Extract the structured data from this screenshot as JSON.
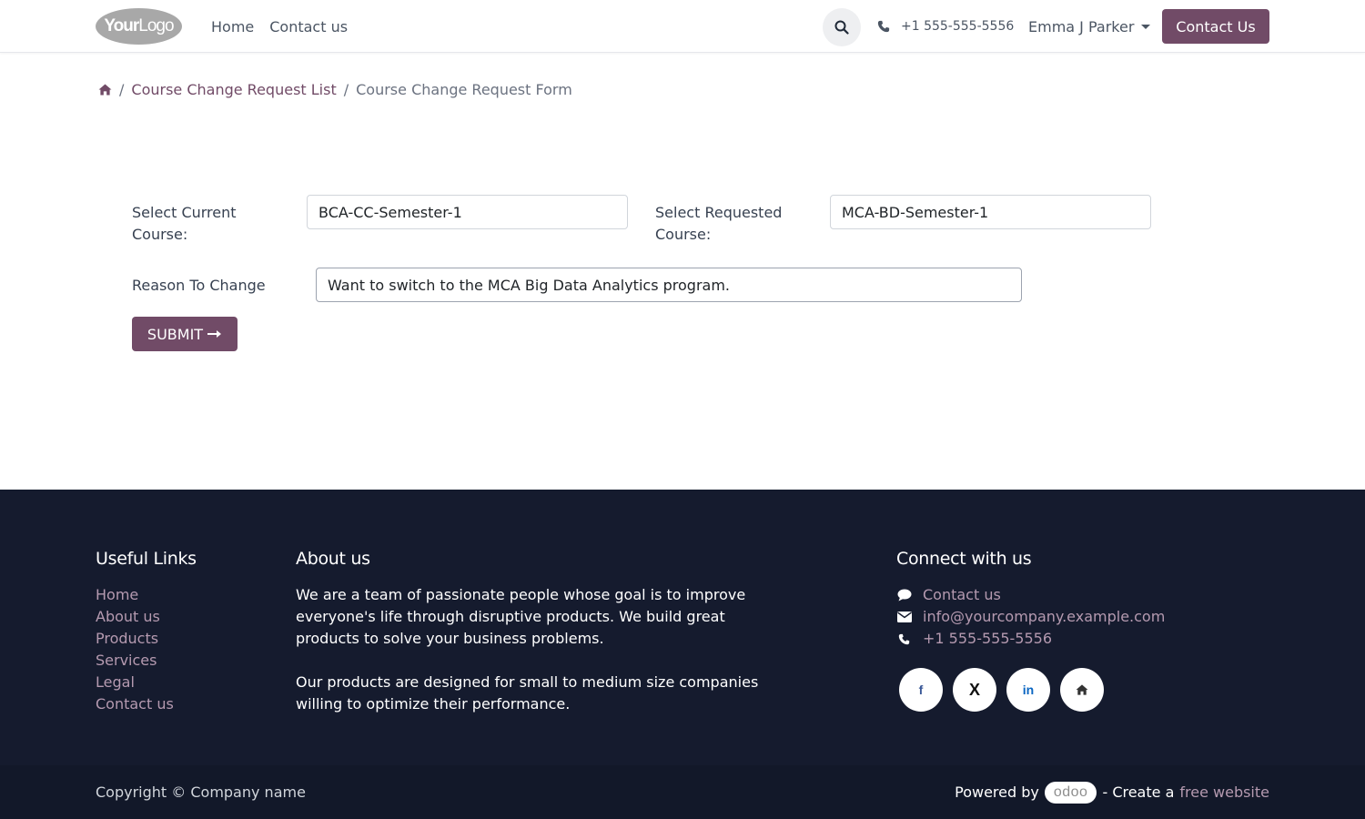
{
  "header": {
    "logo_text_bold": "Your",
    "logo_text": "Logo",
    "nav": [
      "Home",
      "Contact us"
    ],
    "phone": "+1 555-555-5556",
    "user_name": "Emma J Parker",
    "contact_button": "Contact Us"
  },
  "breadcrumb": {
    "items": [
      "Course Change Request List",
      "Course Change Request Form"
    ],
    "separator": "/"
  },
  "form": {
    "current_course_label": "Select Current Course:",
    "current_course_value": "BCA-CC-Semester-1",
    "requested_course_label": "Select Requested Course:",
    "requested_course_value": "MCA-BD-Semester-1",
    "reason_label": "Reason To Change",
    "reason_value": "Want to switch to the MCA Big Data Analytics program.",
    "submit_label": "SUBMIT",
    "submit_icon": "arrow-right-icon"
  },
  "footer": {
    "useful_links_title": "Useful Links",
    "useful_links": [
      "Home",
      "About us",
      "Products",
      "Services",
      "Legal",
      "Contact us"
    ],
    "about_title": "About us",
    "about_p1": "We are a team of passionate people whose goal is to improve everyone's life through disruptive products. We build great products to solve your business problems.",
    "about_p2": "Our products are designed for small to medium size companies willing to optimize their performance.",
    "connect_title": "Connect with us",
    "connect_contact": "Contact us",
    "connect_email": "info@yourcompany.example.com",
    "connect_phone": "+1 555-555-5556",
    "socials": [
      "f",
      "X",
      "in",
      "home-icon"
    ]
  },
  "bottom": {
    "copyright": "Copyright © Company name",
    "powered_by": "Powered by",
    "odoo": "odoo",
    "create_a": "- Create a",
    "free_website": "free website"
  },
  "colors": {
    "brand": "#714b67",
    "footer_bg": "#151b2e",
    "footer_link": "#b59ab0"
  }
}
